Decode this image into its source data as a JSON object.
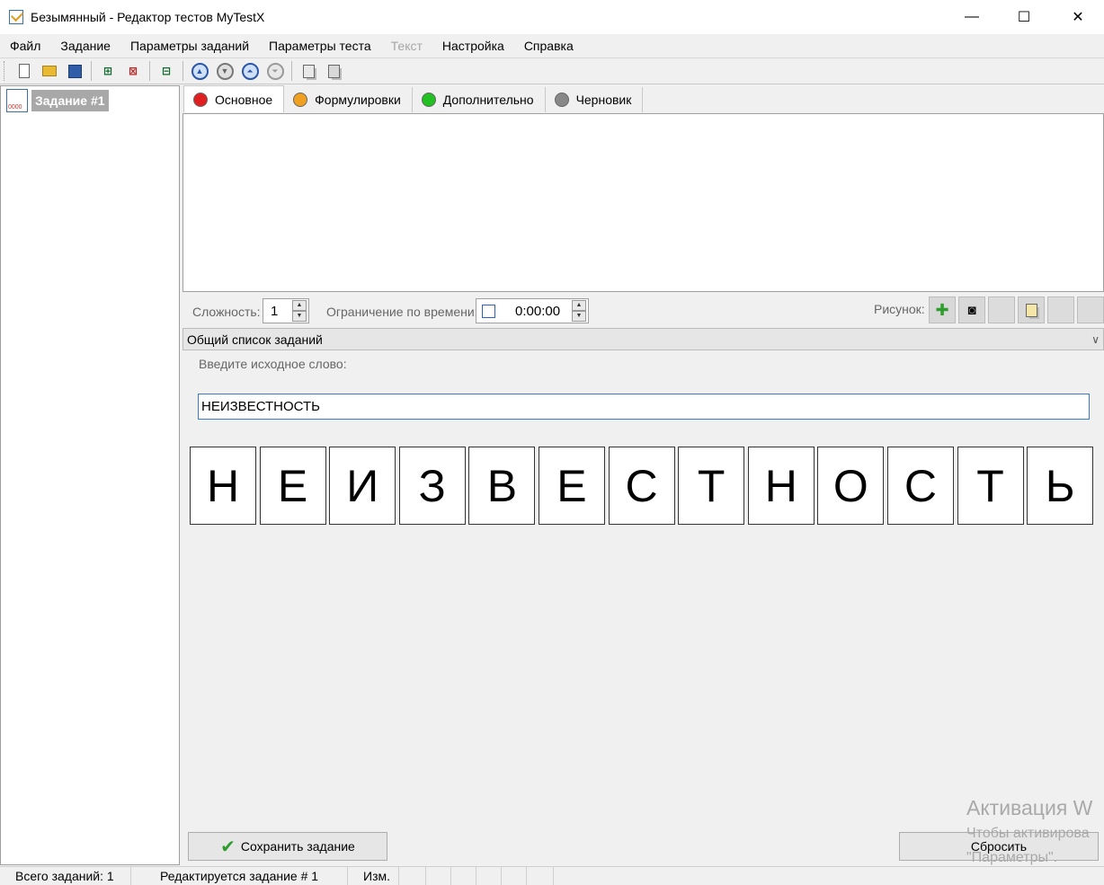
{
  "window": {
    "title": "Безымянный - Редактор тестов MyTestX",
    "minimize": "—",
    "maximize": "☐",
    "close": "✕"
  },
  "menu": [
    {
      "label": "Файл",
      "disabled": false
    },
    {
      "label": "Задание",
      "disabled": false
    },
    {
      "label": "Параметры заданий",
      "disabled": false
    },
    {
      "label": "Параметры теста",
      "disabled": false
    },
    {
      "label": "Текст",
      "disabled": true
    },
    {
      "label": "Настройка",
      "disabled": false
    },
    {
      "label": "Справка",
      "disabled": false
    }
  ],
  "tree": {
    "task_label": "Задание #1"
  },
  "tabs": [
    {
      "label": "Основное",
      "color": "#e02020",
      "active": true
    },
    {
      "label": "Формулировки",
      "color": "#f0a020",
      "active": false
    },
    {
      "label": "Дополнительно",
      "color": "#22c022",
      "active": false
    },
    {
      "label": "Черновик",
      "color": "#888888",
      "active": false
    }
  ],
  "params": {
    "difficulty_label": "Сложность:",
    "difficulty_value": "1",
    "time_limit_label": "Ограничение по времени:",
    "time_limit_value": "0:00:00",
    "picture_label": "Рисунок:"
  },
  "task_type": {
    "selected": "Общий список заданий"
  },
  "word_prompt": "Введите исходное слово:",
  "word_value": "НЕИЗВЕСТНОСТЬ",
  "letters": [
    "Н",
    "Е",
    "И",
    "З",
    "В",
    "Е",
    "С",
    "Т",
    "Н",
    "О",
    "С",
    "Т",
    "Ь"
  ],
  "buttons": {
    "save": "Сохранить задание",
    "reset": "Сбросить"
  },
  "watermark": {
    "line1": "Активация W",
    "line2": "Чтобы активирова",
    "line3": "\"Параметры\"."
  },
  "status": {
    "total": "Всего заданий: 1",
    "editing": "Редактируется задание # 1",
    "modified": "Изм."
  }
}
